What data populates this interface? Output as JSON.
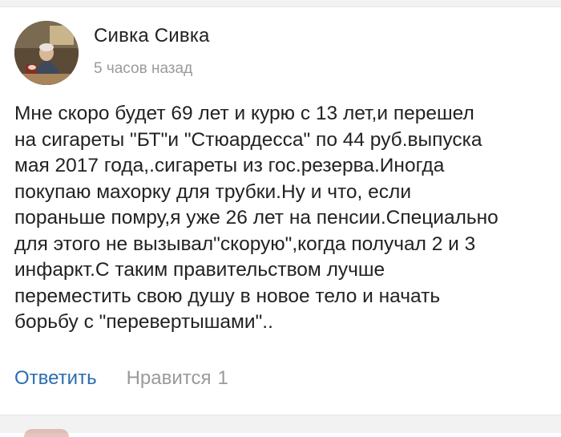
{
  "comment": {
    "author": "Сивка Сивка",
    "time": "5 часов назад",
    "text": "Мне скоро будет 69 лет и курю с 13 лет,и перешел\nна сигареты \"БТ\"и \"Стюардесса\" по 44 руб.выпуска\nмая 2017 года,.сигареты из гос.резерва.Иногда\nпокупаю махорку для трубки.Ну и что, если\nпораньше помру,я уже 26 лет на пенсии.Специально\nдля этого не вызывал\"скорую\",когда получал 2 и 3\nинфаркт.С таким правительством лучше\nпереместить свою душу в новое тело и начать\nборьбу с \"перевертышами\"..",
    "actions": {
      "reply_label": "Ответить",
      "like_label": "Нравится",
      "like_count": "1"
    }
  },
  "colors": {
    "link": "#2a6db0",
    "muted": "#9a9a9a",
    "text": "#222222",
    "divider": "#f2f2f2"
  }
}
